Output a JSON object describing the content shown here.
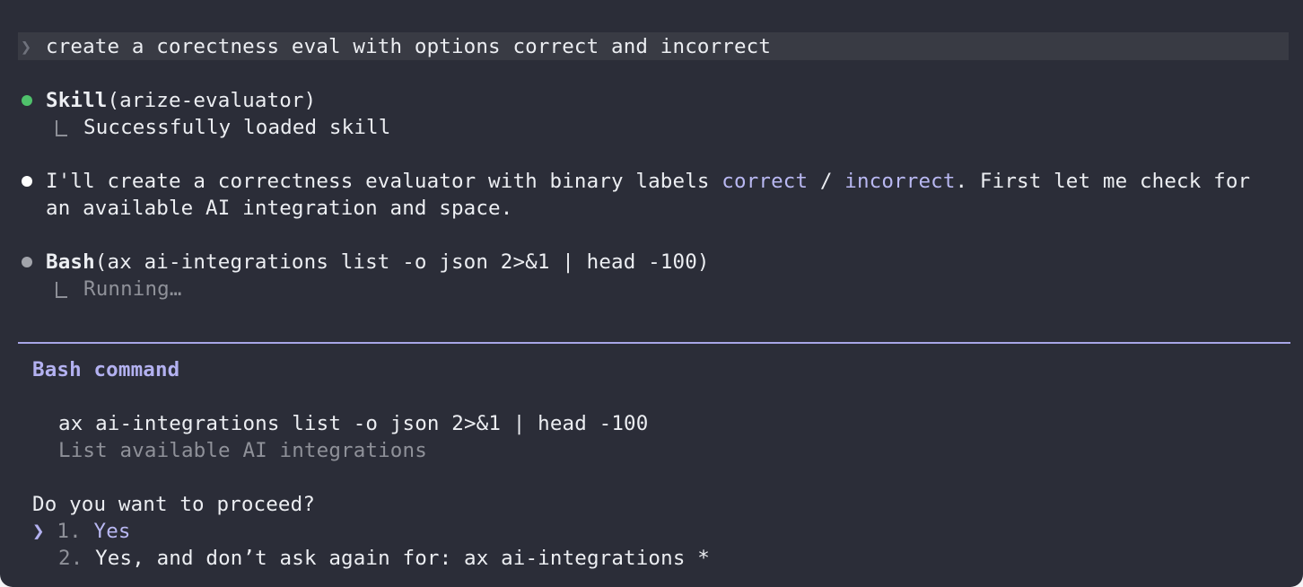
{
  "prompt": {
    "caret": "❯",
    "text": "create a corectness eval with options correct and incorrect"
  },
  "skill_call": {
    "tool": "Skill",
    "args": "(arize-evaluator)",
    "result": "Successfully loaded skill",
    "status_color": "#4fc16b"
  },
  "assistant_message": {
    "line1_before": "I'll create a correctness evaluator with binary labels ",
    "label_correct": "correct",
    "separator": " / ",
    "label_incorrect": "incorrect",
    "line1_after": ". First let me check for",
    "line2": "an available AI integration and space."
  },
  "bash_call": {
    "tool": "Bash",
    "args": "(ax ai-integrations list -o json 2>&1 | head -100)",
    "status": "Running…",
    "status_color": "#a2a4ab"
  },
  "permission_prompt": {
    "title": "Bash command",
    "command": "ax ai-integrations list -o json 2>&1 | head -100",
    "description": "List available AI integrations",
    "question": "Do you want to proceed?",
    "selector": "❯",
    "options": [
      {
        "number": "1.",
        "label": "Yes",
        "selected": true
      },
      {
        "number": "2.",
        "label": "Yes, and don’t ask again for: ax ai-integrations *",
        "selected": false
      }
    ]
  },
  "colors": {
    "background": "#2b2d38",
    "accent": "#b3b1f0",
    "text": "#eceef2",
    "dim_text": "#8f9199"
  }
}
